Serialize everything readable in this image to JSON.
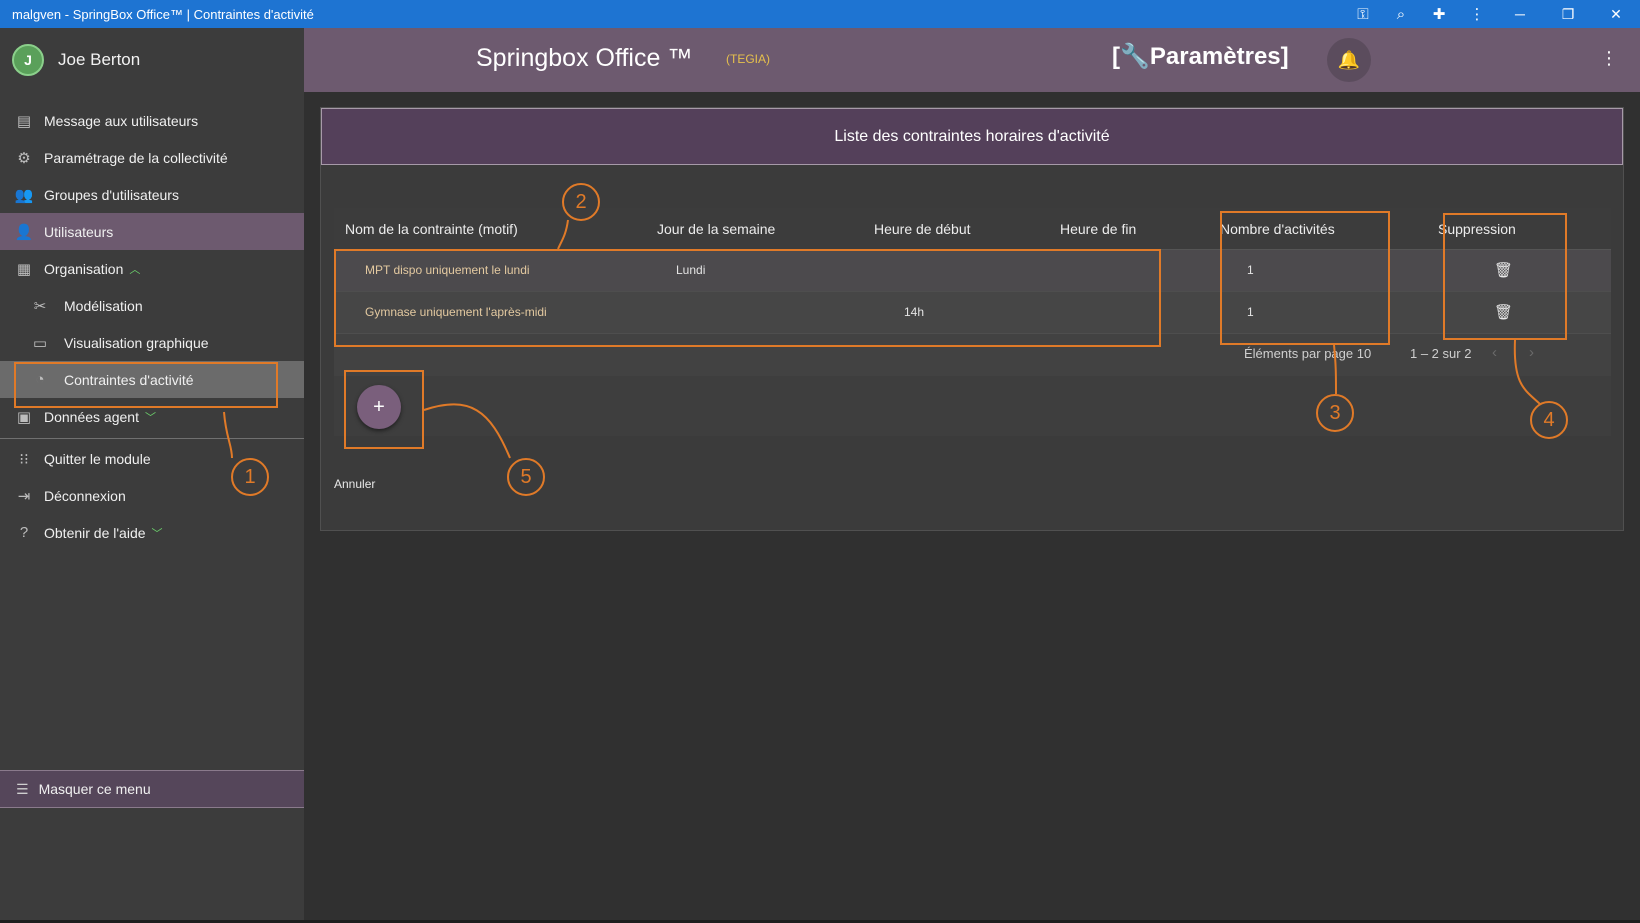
{
  "window": {
    "title": "malgven - SpringBox Office™ | Contraintes d'activité",
    "icons": [
      "key-icon",
      "zoom-icon",
      "extension-icon",
      "more-icon"
    ],
    "buttons": [
      "minimize",
      "restore",
      "close"
    ]
  },
  "sidebar": {
    "user_name": "Joe Berton",
    "avatar_initial": "J",
    "items": [
      {
        "label": "Message aux utilisateurs",
        "icon": "message-icon"
      },
      {
        "label": "Paramétrage de la collectivité",
        "icon": "gear-icon"
      },
      {
        "label": "Groupes d'utilisateurs",
        "icon": "users-icon"
      },
      {
        "label": "Utilisateurs",
        "icon": "add-user-icon"
      },
      {
        "label": "Organisation",
        "icon": "organisation-icon"
      },
      {
        "label": "Modélisation",
        "icon": "tools-icon"
      },
      {
        "label": "Visualisation graphique",
        "icon": "screen-icon"
      },
      {
        "label": "Contraintes d'activité",
        "icon": "clock-icon"
      },
      {
        "label": "Données agent",
        "icon": "agent-icon"
      },
      {
        "label": "Quitter le module",
        "icon": "grid-icon"
      },
      {
        "label": "Déconnexion",
        "icon": "logout-icon"
      },
      {
        "label": "Obtenir de l'aide",
        "icon": "help-icon"
      }
    ],
    "hide_menu_label": "Masquer ce menu"
  },
  "header": {
    "app_title": "Springbox Office ™",
    "org": "(TEGIA)",
    "section": "[🔧Paramètres]"
  },
  "card": {
    "title": "Liste des contraintes horaires d'activité",
    "columns": [
      "Nom de la contrainte (motif)",
      "Jour de la semaine",
      "Heure de début",
      "Heure de fin",
      "Nombre d'activités",
      "Suppression"
    ],
    "rows": [
      {
        "name": "MPT dispo uniquement le lundi",
        "day": "Lundi",
        "start": "",
        "end": "",
        "count": "1"
      },
      {
        "name": "Gymnase uniquement l'après-midi",
        "day": "",
        "start": "14h",
        "end": "",
        "count": "1"
      }
    ],
    "paginator": {
      "items_per_page_label": "Éléments par page",
      "items_per_page": "10",
      "range": "1 – 2 sur 2"
    },
    "add_symbol": "+",
    "cancel_label": "Annuler"
  },
  "annotations": {
    "color": "#e07a28",
    "labels": [
      "1",
      "2",
      "3",
      "4",
      "5"
    ]
  },
  "colors": {
    "titlebar": "#1e74d2",
    "header": "#6d5a6f",
    "sidebar": "#3c3c3c",
    "accent_sub": "#e6c04c"
  }
}
